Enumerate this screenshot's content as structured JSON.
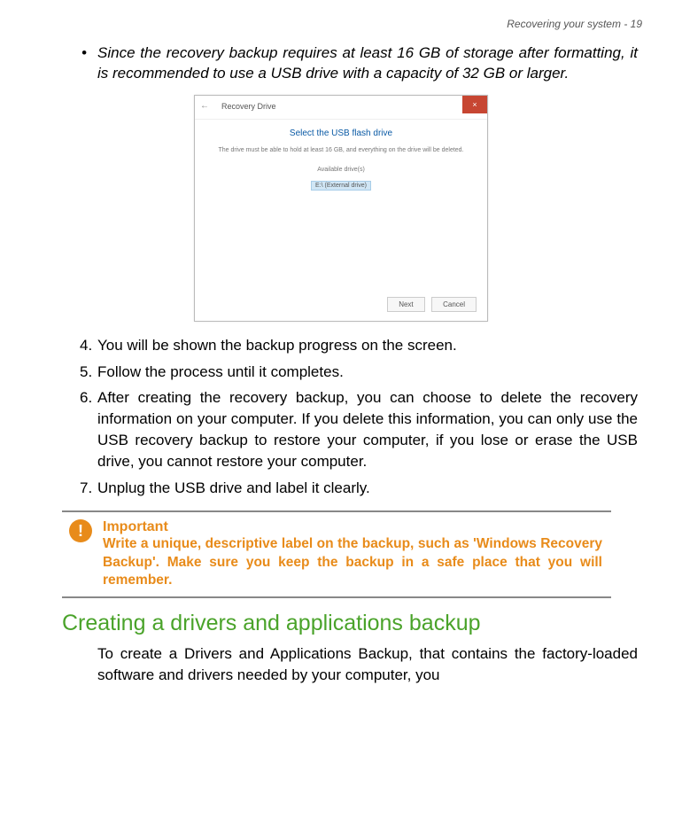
{
  "header": {
    "right": "Recovering your system - 19"
  },
  "bullet": {
    "text": "Since the recovery backup requires at least 16 GB of storage after formatting, it is recommended to use a USB drive with a capacity of 32 GB or larger."
  },
  "screenshot": {
    "title": "Recovery Drive",
    "heading": "Select the USB flash drive",
    "desc": "The drive must be able to hold at least 16 GB, and everything on the drive will be deleted.",
    "avail": "Available drive(s)",
    "drive": "E:\\ (External drive)",
    "next": "Next",
    "cancel": "Cancel",
    "close": "×"
  },
  "steps": {
    "s4": "You will be shown the backup progress on the screen.",
    "s5": "Follow the process until it completes.",
    "s6": "After creating the recovery backup, you can choose to delete the recovery information on your computer. If you delete this information, you can only use the USB recovery backup to restore your computer, if you lose or erase the USB drive, you cannot restore your computer.",
    "s7": "Unplug the USB drive and label it clearly."
  },
  "callout": {
    "icon": "!",
    "title": "Important",
    "body": "Write a unique, descriptive label on the backup, such as 'Windows Recovery Backup'. Make sure you keep the backup in a safe place that you will remember."
  },
  "section": {
    "heading": "Creating a drivers and applications backup",
    "body": "To create a Drivers and Applications Backup, that contains the factory-loaded software and drivers needed by your computer, you"
  }
}
